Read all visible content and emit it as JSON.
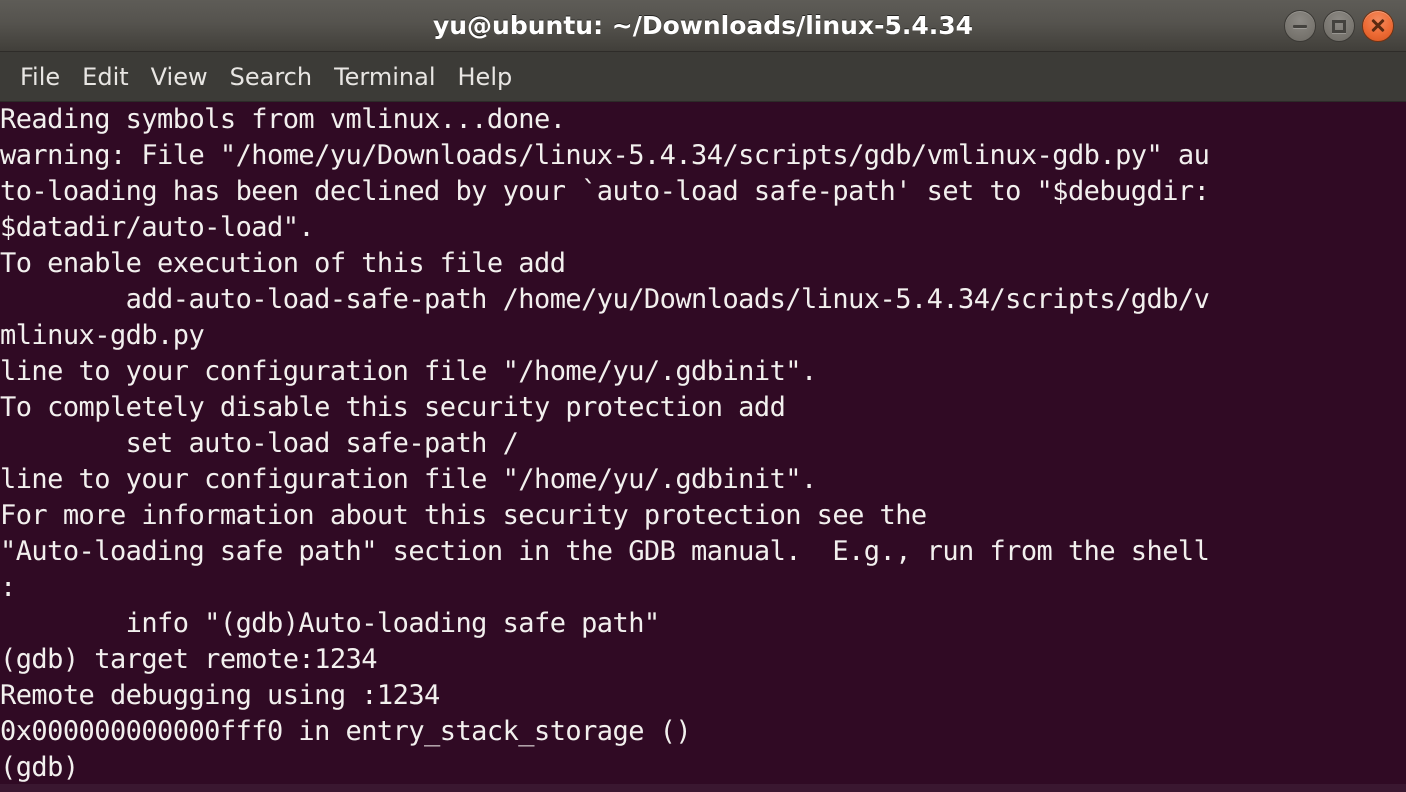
{
  "window": {
    "title": "yu@ubuntu: ~/Downloads/linux-5.4.34",
    "controls": [
      {
        "name": "minimize",
        "label": "–"
      },
      {
        "name": "maximize",
        "label": "□"
      },
      {
        "name": "close",
        "label": "×"
      }
    ]
  },
  "menubar": {
    "items": [
      {
        "id": "file",
        "label": "File"
      },
      {
        "id": "edit",
        "label": "Edit"
      },
      {
        "id": "view",
        "label": "View"
      },
      {
        "id": "search",
        "label": "Search"
      },
      {
        "id": "terminal",
        "label": "Terminal"
      },
      {
        "id": "help",
        "label": "Help"
      }
    ]
  },
  "terminal": {
    "prompt": "(gdb)",
    "colors": {
      "background": "#300a24",
      "foreground": "#f2f0ee",
      "titlebar": "#55534e",
      "menubar": "#3c3b37",
      "close_button": "#ed6b35"
    },
    "lines": [
      "Reading symbols from vmlinux...done.",
      "warning: File \"/home/yu/Downloads/linux-5.4.34/scripts/gdb/vmlinux-gdb.py\" au",
      "to-loading has been declined by your `auto-load safe-path' set to \"$debugdir:",
      "$datadir/auto-load\".",
      "To enable execution of this file add",
      "        add-auto-load-safe-path /home/yu/Downloads/linux-5.4.34/scripts/gdb/v",
      "mlinux-gdb.py",
      "line to your configuration file \"/home/yu/.gdbinit\".",
      "To completely disable this security protection add",
      "        set auto-load safe-path /",
      "line to your configuration file \"/home/yu/.gdbinit\".",
      "For more information about this security protection see the",
      "\"Auto-loading safe path\" section in the GDB manual.  E.g., run from the shell",
      ":",
      "        info \"(gdb)Auto-loading safe path\"",
      "(gdb) target remote:1234",
      "Remote debugging using :1234",
      "0x000000000000fff0 in entry_stack_storage ()",
      "(gdb) "
    ],
    "commands_entered": [
      "target remote:1234"
    ],
    "remote_target": ":1234",
    "address": "0x000000000000fff0",
    "symbol": "entry_stack_storage ()"
  }
}
